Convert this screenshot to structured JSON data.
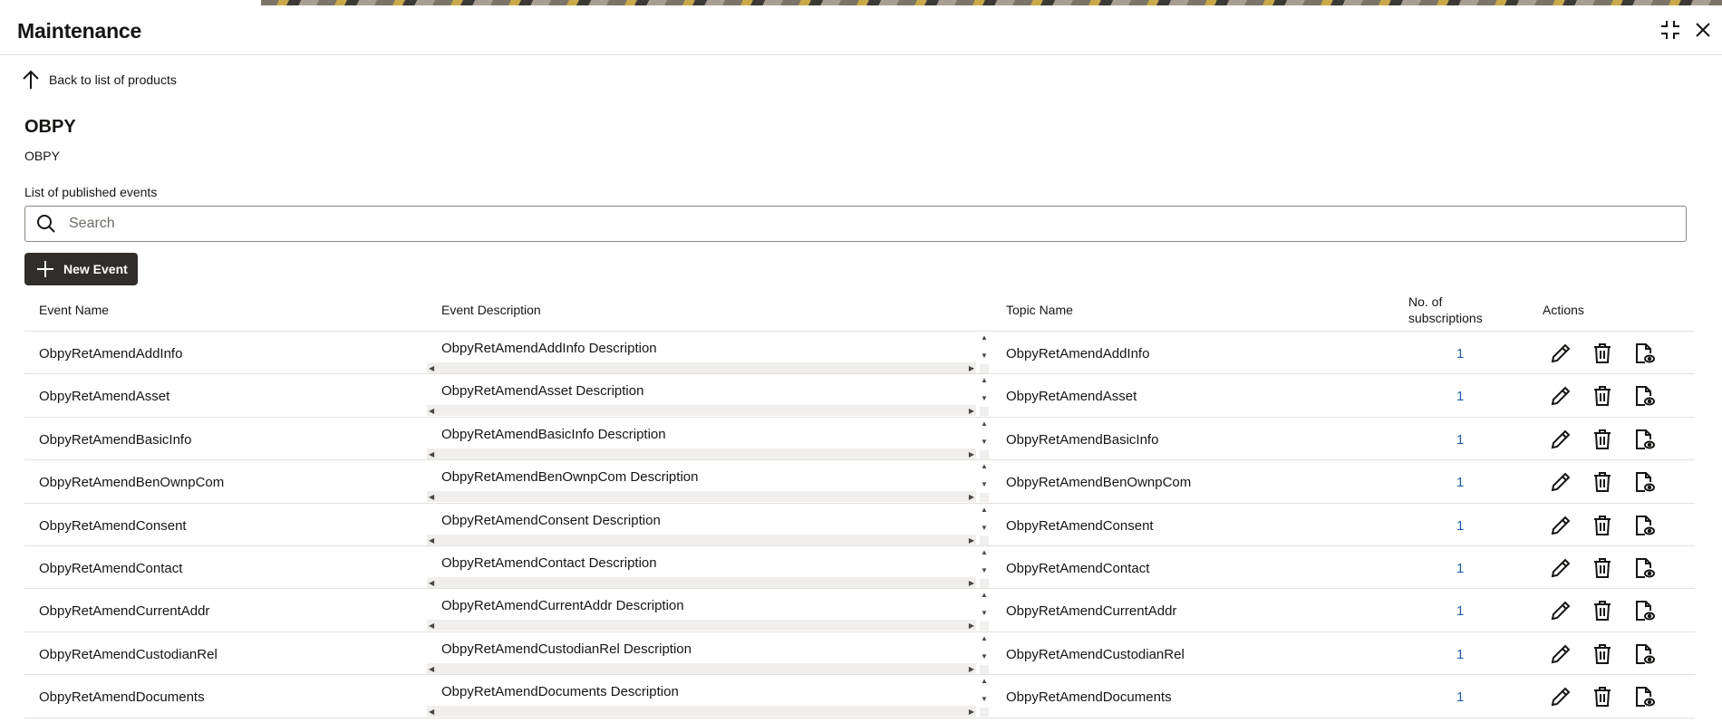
{
  "header": {
    "title": "Maintenance"
  },
  "back_link": {
    "label": "Back to list of products"
  },
  "product": {
    "title": "OBPY",
    "subtitle": "OBPY"
  },
  "list_label": "List of published events",
  "search": {
    "placeholder": "Search",
    "value": ""
  },
  "new_event_button": {
    "label": "New Event"
  },
  "table": {
    "columns": {
      "event_name": "Event Name",
      "event_description": "Event Description",
      "topic_name": "Topic Name",
      "subscriptions_line1": "No. of",
      "subscriptions_line2": "subscriptions",
      "actions": "Actions"
    },
    "rows": [
      {
        "name": "ObpyRetAmendAddInfo",
        "description": "ObpyRetAmendAddInfo Description",
        "topic": "ObpyRetAmendAddInfo",
        "subscriptions": "1"
      },
      {
        "name": "ObpyRetAmendAsset",
        "description": "ObpyRetAmendAsset Description",
        "topic": "ObpyRetAmendAsset",
        "subscriptions": "1"
      },
      {
        "name": "ObpyRetAmendBasicInfo",
        "description": "ObpyRetAmendBasicInfo Description",
        "topic": "ObpyRetAmendBasicInfo",
        "subscriptions": "1"
      },
      {
        "name": "ObpyRetAmendBenOwnpCom",
        "description": "ObpyRetAmendBenOwnpCom Description",
        "topic": "ObpyRetAmendBenOwnpCom",
        "subscriptions": "1"
      },
      {
        "name": "ObpyRetAmendConsent",
        "description": "ObpyRetAmendConsent Description",
        "topic": "ObpyRetAmendConsent",
        "subscriptions": "1"
      },
      {
        "name": "ObpyRetAmendContact",
        "description": "ObpyRetAmendContact Description",
        "topic": "ObpyRetAmendContact",
        "subscriptions": "1"
      },
      {
        "name": "ObpyRetAmendCurrentAddr",
        "description": "ObpyRetAmendCurrentAddr Description",
        "topic": "ObpyRetAmendCurrentAddr",
        "subscriptions": "1"
      },
      {
        "name": "ObpyRetAmendCustodianRel",
        "description": "ObpyRetAmendCustodianRel Description",
        "topic": "ObpyRetAmendCustodianRel",
        "subscriptions": "1"
      },
      {
        "name": "ObpyRetAmendDocuments",
        "description": "ObpyRetAmendDocuments Description",
        "topic": "ObpyRetAmendDocuments",
        "subscriptions": "1"
      }
    ]
  },
  "icons": {
    "collapse": "collapse-icon",
    "close": "close-icon",
    "back": "arrow-up-icon",
    "search": "search-icon",
    "add": "plus-icon",
    "edit": "pencil-icon",
    "delete": "trash-icon",
    "view": "document-view-icon"
  },
  "colors": {
    "primary_button": "#312d2a",
    "link": "#1e5da8",
    "divider": "#e4e1dd"
  }
}
